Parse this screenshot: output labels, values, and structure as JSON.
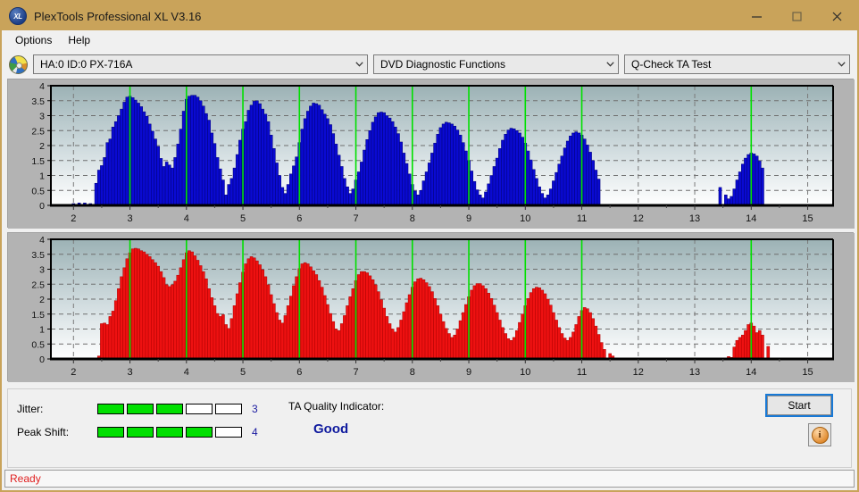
{
  "window": {
    "title": "PlexTools Professional XL V3.16",
    "app_icon": "xl-disc-icon",
    "minimize_label": "–",
    "maximize_label": "□",
    "close_label": "✕"
  },
  "menu": {
    "items": [
      {
        "label": "Options"
      },
      {
        "label": "Help"
      }
    ]
  },
  "toolbar": {
    "drive_icon": "optical-disc-icon",
    "drive": "HA:0 ID:0  PX-716A",
    "function": "DVD Diagnostic Functions",
    "test": "Q-Check TA Test"
  },
  "indicators": {
    "jitter_label": "Jitter:",
    "jitter_value": "3",
    "jitter_filled": 3,
    "jitter_total": 5,
    "peak_shift_label": "Peak Shift:",
    "peak_shift_value": "4",
    "peak_shift_filled": 4,
    "peak_shift_total": 5,
    "ta_title": "TA Quality Indicator:",
    "ta_value": "Good",
    "led_on_color": "#00e000",
    "led_off_color": "#ffffff"
  },
  "actions": {
    "start_label": "Start",
    "info_label": "i",
    "info_icon": "info-icon"
  },
  "status": {
    "text": "Ready",
    "color": "#e02020"
  },
  "chart_data": [
    {
      "type": "bar",
      "name": "ta-test-chart-top",
      "series_color": "#0a0ad2",
      "bar_edge_color": "#00007a",
      "title": "",
      "xlabel": "",
      "ylabel": "",
      "xlim": [
        1.6,
        15.45
      ],
      "ylim": [
        0,
        4
      ],
      "yticks": [
        0,
        0.5,
        1,
        1.5,
        2,
        2.5,
        3,
        3.5,
        4
      ],
      "ytick_labels": [
        "0",
        "0.5",
        "1",
        "1.5",
        "2",
        "2.5",
        "3",
        "3.5",
        "4"
      ],
      "xticks": [
        2,
        3,
        4,
        5,
        6,
        7,
        8,
        9,
        10,
        11,
        12,
        13,
        14,
        15
      ],
      "xtick_labels": [
        "2",
        "3",
        "4",
        "5",
        "6",
        "7",
        "8",
        "9",
        "10",
        "11",
        "12",
        "13",
        "14",
        "15"
      ],
      "grid": true,
      "marker_lines_x": [
        3,
        4,
        5,
        6,
        7,
        8,
        9,
        10,
        11,
        14
      ],
      "marker_line_color": "#00e000",
      "x": [
        1.7,
        1.8,
        1.9,
        2.0,
        2.1,
        2.2,
        2.3,
        2.4,
        2.45,
        2.5,
        2.55,
        2.6,
        2.65,
        2.7,
        2.75,
        2.8,
        2.85,
        2.9,
        2.95,
        3.0,
        3.05,
        3.1,
        3.15,
        3.2,
        3.25,
        3.3,
        3.35,
        3.4,
        3.45,
        3.5,
        3.55,
        3.6,
        3.65,
        3.7,
        3.75,
        3.8,
        3.85,
        3.9,
        3.95,
        4.0,
        4.05,
        4.1,
        4.15,
        4.2,
        4.25,
        4.3,
        4.35,
        4.4,
        4.45,
        4.5,
        4.55,
        4.6,
        4.65,
        4.7,
        4.75,
        4.8,
        4.85,
        4.9,
        4.95,
        5.0,
        5.05,
        5.1,
        5.15,
        5.2,
        5.25,
        5.3,
        5.35,
        5.4,
        5.45,
        5.5,
        5.55,
        5.6,
        5.65,
        5.7,
        5.75,
        5.8,
        5.85,
        5.9,
        5.95,
        6.0,
        6.05,
        6.1,
        6.15,
        6.2,
        6.25,
        6.3,
        6.35,
        6.4,
        6.45,
        6.5,
        6.55,
        6.6,
        6.65,
        6.7,
        6.75,
        6.8,
        6.85,
        6.9,
        6.95,
        7.0,
        7.05,
        7.1,
        7.15,
        7.2,
        7.25,
        7.3,
        7.35,
        7.4,
        7.45,
        7.5,
        7.55,
        7.6,
        7.65,
        7.7,
        7.75,
        7.8,
        7.85,
        7.9,
        7.95,
        8.0,
        8.05,
        8.1,
        8.15,
        8.2,
        8.25,
        8.3,
        8.35,
        8.4,
        8.45,
        8.5,
        8.55,
        8.6,
        8.65,
        8.7,
        8.75,
        8.8,
        8.85,
        8.9,
        8.95,
        9.0,
        9.05,
        9.1,
        9.15,
        9.2,
        9.25,
        9.3,
        9.35,
        9.4,
        9.45,
        9.5,
        9.55,
        9.6,
        9.65,
        9.7,
        9.75,
        9.8,
        9.85,
        9.9,
        9.95,
        10.0,
        10.05,
        10.1,
        10.15,
        10.2,
        10.25,
        10.3,
        10.35,
        10.4,
        10.45,
        10.5,
        10.55,
        10.6,
        10.65,
        10.7,
        10.75,
        10.8,
        10.85,
        10.9,
        10.95,
        11.0,
        11.05,
        11.1,
        11.15,
        11.2,
        11.25,
        11.3,
        13.45,
        13.55,
        13.6,
        13.65,
        13.7,
        13.75,
        13.8,
        13.85,
        13.9,
        13.95,
        14.0,
        14.05,
        14.1,
        14.15,
        14.2
      ],
      "values": [
        0.0,
        0.0,
        0.0,
        0.06,
        0.08,
        0.08,
        0.06,
        0.74,
        1.18,
        1.33,
        1.6,
        2.1,
        2.22,
        2.62,
        2.8,
        3.0,
        3.22,
        3.45,
        3.62,
        3.65,
        3.6,
        3.52,
        3.42,
        3.3,
        3.13,
        2.98,
        2.72,
        2.48,
        2.22,
        1.97,
        1.57,
        1.3,
        1.45,
        1.35,
        1.25,
        1.6,
        2.05,
        2.55,
        3.15,
        3.55,
        3.65,
        3.68,
        3.68,
        3.62,
        3.5,
        3.32,
        3.07,
        2.85,
        2.42,
        2.07,
        1.6,
        1.22,
        0.85,
        0.35,
        0.7,
        0.9,
        1.25,
        1.7,
        2.18,
        2.55,
        2.8,
        3.18,
        3.35,
        3.48,
        3.5,
        3.4,
        3.22,
        3.05,
        2.8,
        2.35,
        1.9,
        1.42,
        1.0,
        0.6,
        0.4,
        0.7,
        1.05,
        1.32,
        1.62,
        2.1,
        2.55,
        2.9,
        3.15,
        3.32,
        3.42,
        3.4,
        3.35,
        3.2,
        3.05,
        2.9,
        2.7,
        2.4,
        2.05,
        1.68,
        1.3,
        0.9,
        0.62,
        0.4,
        0.55,
        0.85,
        1.12,
        1.45,
        1.85,
        2.2,
        2.5,
        2.78,
        2.96,
        3.1,
        3.12,
        3.1,
        3.0,
        2.92,
        2.8,
        2.62,
        2.4,
        2.12,
        1.75,
        1.4,
        1.05,
        0.7,
        0.48,
        0.35,
        0.5,
        0.82,
        1.12,
        1.42,
        1.75,
        2.08,
        2.38,
        2.6,
        2.72,
        2.78,
        2.76,
        2.72,
        2.65,
        2.52,
        2.35,
        2.1,
        1.82,
        1.5,
        1.15,
        0.8,
        0.52,
        0.35,
        0.25,
        0.45,
        0.72,
        1.0,
        1.3,
        1.58,
        1.9,
        2.18,
        2.38,
        2.52,
        2.58,
        2.56,
        2.5,
        2.42,
        2.28,
        2.08,
        1.82,
        1.52,
        1.2,
        0.9,
        0.62,
        0.4,
        0.25,
        0.35,
        0.55,
        0.82,
        1.1,
        1.38,
        1.65,
        1.92,
        2.15,
        2.32,
        2.42,
        2.46,
        2.42,
        2.35,
        2.22,
        2.02,
        1.78,
        1.5,
        1.18,
        0.88,
        0.6,
        0.35,
        0.22,
        0.3,
        0.55,
        0.85,
        1.12,
        1.38,
        1.58,
        1.7,
        1.75,
        1.72,
        1.65,
        1.48,
        1.25,
        0.95,
        0.62,
        0.35,
        0.18,
        0.1,
        0.12,
        0.42,
        0.9,
        1.3,
        1.58,
        1.8,
        1.96,
        2.08,
        2.15,
        2.18,
        2.12,
        1.95,
        1.55,
        0.95,
        0.45
      ]
    },
    {
      "type": "bar",
      "name": "ta-test-chart-bottom",
      "series_color": "#ee1111",
      "bar_edge_color": "#b00000",
      "title": "",
      "xlabel": "",
      "ylabel": "",
      "xlim": [
        1.6,
        15.45
      ],
      "ylim": [
        0,
        4
      ],
      "yticks": [
        0,
        0.5,
        1,
        1.5,
        2,
        2.5,
        3,
        3.5,
        4
      ],
      "ytick_labels": [
        "0",
        "0.5",
        "1",
        "1.5",
        "2",
        "2.5",
        "3",
        "3.5",
        "4"
      ],
      "xticks": [
        2,
        3,
        4,
        5,
        6,
        7,
        8,
        9,
        10,
        11,
        12,
        13,
        14,
        15
      ],
      "xtick_labels": [
        "2",
        "3",
        "4",
        "5",
        "6",
        "7",
        "8",
        "9",
        "10",
        "11",
        "12",
        "13",
        "14",
        "15"
      ],
      "grid": true,
      "marker_lines_x": [
        3,
        4,
        5,
        6,
        7,
        8,
        9,
        10,
        11,
        14
      ],
      "marker_line_color": "#00e000",
      "x": [
        2.45,
        2.5,
        2.55,
        2.6,
        2.65,
        2.7,
        2.75,
        2.8,
        2.85,
        2.9,
        2.95,
        3.0,
        3.05,
        3.1,
        3.15,
        3.2,
        3.25,
        3.3,
        3.35,
        3.4,
        3.45,
        3.5,
        3.55,
        3.6,
        3.65,
        3.7,
        3.75,
        3.8,
        3.85,
        3.9,
        3.95,
        4.0,
        4.05,
        4.1,
        4.15,
        4.2,
        4.25,
        4.3,
        4.35,
        4.4,
        4.45,
        4.5,
        4.55,
        4.6,
        4.65,
        4.7,
        4.75,
        4.8,
        4.85,
        4.9,
        4.95,
        5.0,
        5.05,
        5.1,
        5.15,
        5.2,
        5.25,
        5.3,
        5.35,
        5.4,
        5.45,
        5.5,
        5.55,
        5.6,
        5.65,
        5.7,
        5.75,
        5.8,
        5.85,
        5.9,
        5.95,
        6.0,
        6.05,
        6.1,
        6.15,
        6.2,
        6.25,
        6.3,
        6.35,
        6.4,
        6.45,
        6.5,
        6.55,
        6.6,
        6.65,
        6.7,
        6.75,
        6.8,
        6.85,
        6.9,
        6.95,
        7.0,
        7.05,
        7.1,
        7.15,
        7.2,
        7.25,
        7.3,
        7.35,
        7.4,
        7.45,
        7.5,
        7.55,
        7.6,
        7.65,
        7.7,
        7.75,
        7.8,
        7.85,
        7.9,
        7.95,
        8.0,
        8.05,
        8.1,
        8.15,
        8.2,
        8.25,
        8.3,
        8.35,
        8.4,
        8.45,
        8.5,
        8.55,
        8.6,
        8.65,
        8.7,
        8.75,
        8.8,
        8.85,
        8.9,
        8.95,
        9.0,
        9.05,
        9.1,
        9.15,
        9.2,
        9.25,
        9.3,
        9.35,
        9.4,
        9.45,
        9.5,
        9.55,
        9.6,
        9.65,
        9.7,
        9.75,
        9.8,
        9.85,
        9.9,
        9.95,
        10.0,
        10.05,
        10.1,
        10.15,
        10.2,
        10.25,
        10.3,
        10.35,
        10.4,
        10.45,
        10.5,
        10.55,
        10.6,
        10.65,
        10.7,
        10.75,
        10.8,
        10.85,
        10.9,
        10.95,
        11.0,
        11.05,
        11.1,
        11.15,
        11.2,
        11.25,
        11.3,
        11.35,
        11.4,
        11.5,
        11.55,
        13.6,
        13.65,
        13.7,
        13.75,
        13.8,
        13.85,
        13.9,
        13.95,
        14.0,
        14.05,
        14.1,
        14.15,
        14.2,
        14.3
      ],
      "values": [
        0.1,
        1.18,
        1.2,
        1.15,
        1.42,
        1.6,
        1.95,
        2.35,
        2.75,
        3.05,
        3.35,
        3.55,
        3.68,
        3.7,
        3.68,
        3.62,
        3.58,
        3.5,
        3.42,
        3.32,
        3.22,
        3.1,
        2.92,
        2.72,
        2.48,
        2.42,
        2.48,
        2.6,
        2.8,
        3.05,
        3.32,
        3.55,
        3.62,
        3.58,
        3.45,
        3.3,
        3.12,
        2.92,
        2.68,
        2.35,
        2.05,
        1.78,
        1.52,
        1.42,
        1.48,
        1.15,
        1.02,
        1.35,
        1.78,
        2.18,
        2.55,
        2.9,
        3.18,
        3.35,
        3.42,
        3.38,
        3.28,
        3.15,
        2.98,
        2.75,
        2.48,
        2.15,
        1.85,
        1.55,
        1.3,
        1.2,
        1.45,
        1.78,
        2.1,
        2.45,
        2.75,
        3.02,
        3.18,
        3.22,
        3.18,
        3.08,
        2.95,
        2.82,
        2.62,
        2.4,
        2.12,
        1.82,
        1.52,
        1.25,
        1.0,
        0.95,
        1.18,
        1.45,
        1.78,
        2.08,
        2.35,
        2.62,
        2.82,
        2.92,
        2.92,
        2.88,
        2.78,
        2.65,
        2.48,
        2.25,
        1.98,
        1.7,
        1.42,
        1.18,
        1.0,
        0.9,
        1.05,
        1.3,
        1.58,
        1.88,
        2.15,
        2.4,
        2.58,
        2.68,
        2.7,
        2.65,
        2.55,
        2.42,
        2.25,
        2.02,
        1.78,
        1.5,
        1.25,
        1.02,
        0.85,
        0.72,
        0.8,
        1.0,
        1.28,
        1.55,
        1.82,
        2.08,
        2.3,
        2.45,
        2.52,
        2.52,
        2.45,
        2.35,
        2.2,
        2.02,
        1.8,
        1.55,
        1.3,
        1.05,
        0.85,
        0.68,
        0.62,
        0.72,
        0.95,
        1.22,
        1.5,
        1.78,
        2.02,
        2.22,
        2.35,
        2.4,
        2.38,
        2.3,
        2.18,
        2.0,
        1.8,
        1.55,
        1.3,
        1.05,
        0.85,
        0.7,
        0.62,
        0.72,
        0.9,
        1.15,
        1.42,
        1.62,
        1.72,
        1.68,
        1.55,
        1.35,
        1.1,
        0.82,
        0.55,
        0.32,
        0.18,
        0.1,
        0.08,
        0.05,
        0.4,
        0.62,
        0.72,
        0.8,
        0.95,
        1.15,
        1.2,
        1.1,
        0.88,
        0.95,
        0.8,
        0.42,
        0.15
      ]
    }
  ]
}
